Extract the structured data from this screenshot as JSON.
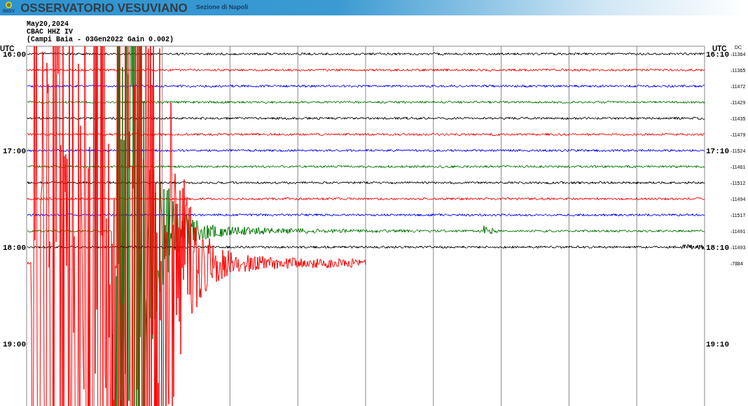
{
  "header": {
    "logo_text": "INGV",
    "title": "OSSERVATORIO VESUVIANO",
    "subtitle": "Sezione di Napoli"
  },
  "info_lines": [
    "May20,2024",
    "CBAC HHZ IV",
    "(Campi Baia - 03Gen2022 Gain 0.002)"
  ],
  "left_axis": {
    "title": "UTC",
    "labels": [
      "16:00",
      "17:00",
      "18:00",
      "19:00"
    ]
  },
  "right_axis": {
    "title": "UTC",
    "labels": [
      "16:10",
      "17:10",
      "18:10",
      "19:10"
    ]
  },
  "dc_title": "DC",
  "traces": [
    {
      "color": "#000000",
      "dc": "-11364"
    },
    {
      "color": "#ff0000",
      "dc": "-11365"
    },
    {
      "color": "#0000ff",
      "dc": "-11472"
    },
    {
      "color": "#007700",
      "dc": "-11429"
    },
    {
      "color": "#000000",
      "dc": "-11435"
    },
    {
      "color": "#ff0000",
      "dc": "-11479"
    },
    {
      "color": "#0000ff",
      "dc": "-11524"
    },
    {
      "color": "#007700",
      "dc": "-11461"
    },
    {
      "color": "#000000",
      "dc": "-11512"
    },
    {
      "color": "#ff0000",
      "dc": "-11494"
    },
    {
      "color": "#0000ff",
      "dc": "-11517"
    },
    {
      "color": "#007700",
      "dc": "-11491"
    },
    {
      "color": "#000000",
      "dc": "-11493"
    },
    {
      "color": "#ff0000",
      "dc": "-7884"
    }
  ]
}
